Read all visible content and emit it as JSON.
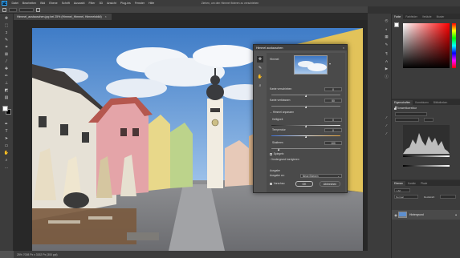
{
  "menubar": {
    "items": [
      "Datei",
      "Bearbeiten",
      "Bild",
      "Ebene",
      "Schrift",
      "Auswahl",
      "Filter",
      "3D",
      "Ansicht",
      "Plug-ins",
      "Fenster",
      "Hilfe"
    ],
    "window_title": "Ziehen, um den Himmel fixieren zu verschieben"
  },
  "document": {
    "tab_title": "Himmel_austauschen.jpg bei 25% (Himmel_Himmel, Himmelsbild)",
    "status": "25%  7008 Px x 3152 Px (300 ppi)"
  },
  "dialog": {
    "title": "Himmel austauschen",
    "sky_label": "Himmel:",
    "shift_edge_label": "Kante verschieben",
    "shift_edge_value": "0",
    "fade_edge_label": "Kante verblassen",
    "fade_edge_value": "50",
    "sky_adjust_label": "Himmel anpassen",
    "brightness_label": "Helligkeit",
    "brightness_value": "0",
    "temperature_label": "Temperatur",
    "temperature_value": "0",
    "scale_label": "Skalieren",
    "scale_value": "100",
    "flip_label": "Spiegeln",
    "fg_adjust_label": "Vordergrund korrigieren",
    "output_label": "Ausgabe",
    "output_to_label": "Ausgabe an:",
    "output_to_value": "Neue Ebenen",
    "preview_label": "Vorschau",
    "ok_label": "OK",
    "cancel_label": "Abbrechen"
  },
  "panels": {
    "color_tabs": [
      "Farbe",
      "Farbfelder",
      "Verläufe",
      "Muster"
    ],
    "props_tabs": [
      "Eigenschaften",
      "Korrekturen",
      "Bibliotheken"
    ],
    "props_layer_label": "Tonwertkorrektur",
    "layers_tabs": [
      "Ebenen",
      "Kanäle",
      "Pfade"
    ],
    "layer_filter": "Art",
    "blend_mode": "Normal",
    "opacity_label": "Deckkraft:",
    "layer_name": "Hintergrund"
  },
  "colors": {
    "accent": "#31a8ff",
    "picker_hue": "#ff0000"
  }
}
